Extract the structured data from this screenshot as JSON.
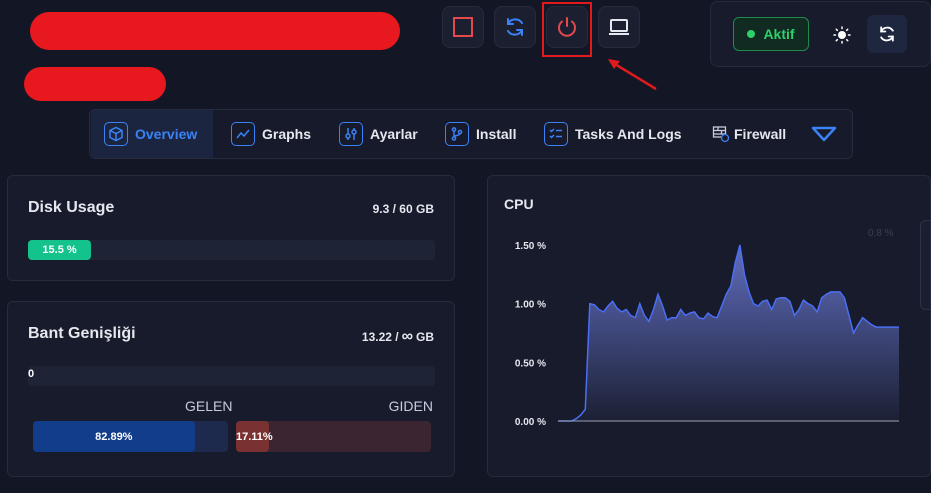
{
  "toolbar": {
    "buttons": [
      {
        "name": "stop-button",
        "icon": "stop-square-icon",
        "color": "#e5484d"
      },
      {
        "name": "restart-button",
        "icon": "refresh-icon",
        "color": "#3b82f6"
      },
      {
        "name": "power-button",
        "icon": "power-icon",
        "color": "#e5484d"
      },
      {
        "name": "console-button",
        "icon": "laptop-icon",
        "color": "#e6e8ef"
      }
    ]
  },
  "status": {
    "label": "Aktif",
    "color": "#2fcf6a"
  },
  "nav": {
    "items": [
      {
        "label": "Overview",
        "icon": "cube-icon",
        "active": true
      },
      {
        "label": "Graphs",
        "icon": "line-graph-icon",
        "active": false
      },
      {
        "label": "Ayarlar",
        "icon": "sliders-icon",
        "active": false
      },
      {
        "label": "Install",
        "icon": "git-branch-icon",
        "active": false
      },
      {
        "label": "Tasks And Logs",
        "icon": "checklist-icon",
        "active": false
      },
      {
        "label": "Firewall",
        "icon": "firewall-icon",
        "active": false
      }
    ],
    "more_icon": "chevron-down-icon"
  },
  "disk": {
    "title": "Disk Usage",
    "usage": "9.3 / 60 GB",
    "percent_label": "15.5 %",
    "percent": 15.5,
    "color": "#14c28b"
  },
  "bandwidth": {
    "title": "Bant Genişliği",
    "usage_value": "13.22 /",
    "usage_unit": "GB",
    "infinity": "∞",
    "track_value": "0",
    "gelen_label": "GELEN",
    "giden_label": "GIDEN",
    "gelen_percent_label": "82.89%",
    "gelen_percent": 82.89,
    "giden_percent_label": "17.11%",
    "giden_percent": 17.11
  },
  "chart_data": {
    "type": "area",
    "title": "CPU",
    "ylim": [
      0,
      1.5
    ],
    "yticks": [
      "1.50 %",
      "1.00 %",
      "0.50 %",
      "0.00 %"
    ],
    "faded_label": "0.8 %",
    "color": "#6d7bd8",
    "values": [
      0,
      0,
      0,
      0,
      0.02,
      0.05,
      0.1,
      1.0,
      0.99,
      0.95,
      0.93,
      0.98,
      1.02,
      0.96,
      0.93,
      0.95,
      0.9,
      0.88,
      1.0,
      0.9,
      0.85,
      0.95,
      1.08,
      0.98,
      0.86,
      0.88,
      0.88,
      0.95,
      0.9,
      0.92,
      0.93,
      0.88,
      0.87,
      0.92,
      0.89,
      0.88,
      0.98,
      1.08,
      1.15,
      1.35,
      1.5,
      1.25,
      1.1,
      1.0,
      0.98,
      1.02,
      1.03,
      0.95,
      1.04,
      1.05,
      1.05,
      1.02,
      0.9,
      0.95,
      1.03,
      1.0,
      0.98,
      0.93,
      1.05,
      1.08,
      1.1,
      1.1,
      1.1,
      1.05,
      0.9,
      0.75,
      0.82,
      0.88,
      0.85,
      0.82,
      0.8,
      0.8,
      0.8,
      0.8,
      0.8,
      0.8
    ]
  }
}
